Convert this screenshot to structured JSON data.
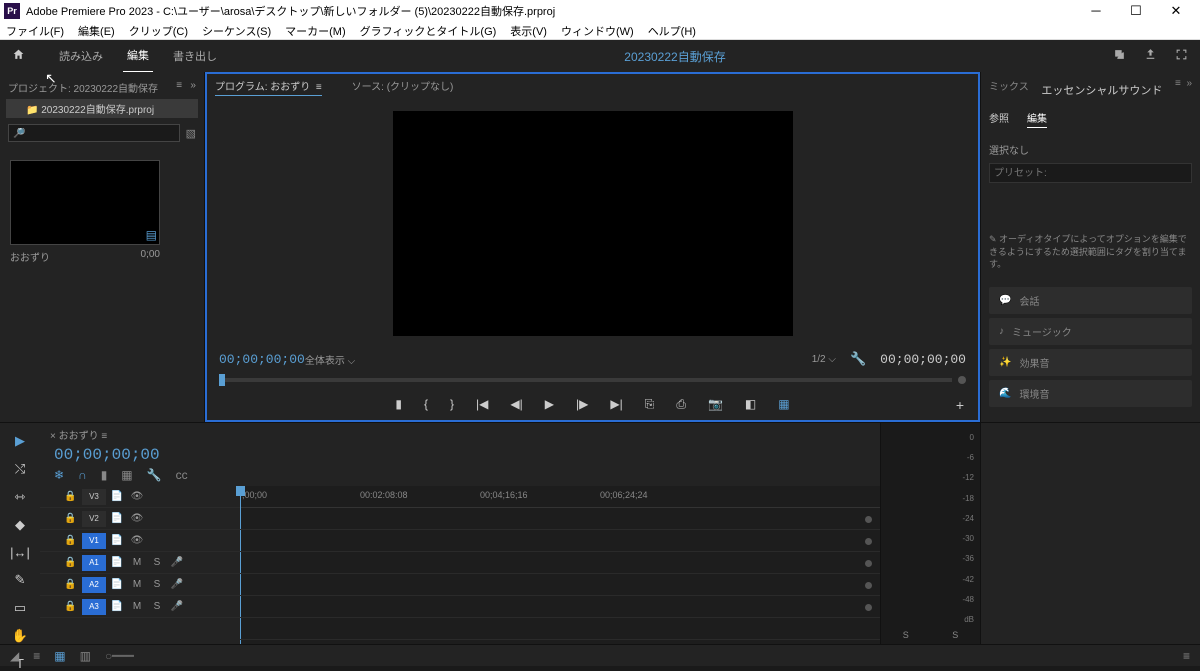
{
  "titlebar": {
    "app_icon": "Pr",
    "title": "Adobe Premiere Pro 2023 - C:\\ユーザー\\arosa\\デスクトップ\\新しいフォルダー (5)\\20230222自動保存.prproj"
  },
  "menubar": {
    "items": [
      "ファイル(F)",
      "編集(E)",
      "クリップ(C)",
      "シーケンス(S)",
      "マーカー(M)",
      "グラフィックとタイトル(G)",
      "表示(V)",
      "ウィンドウ(W)",
      "ヘルプ(H)"
    ]
  },
  "workspace": {
    "tabs": [
      "読み込み",
      "編集",
      "書き出し"
    ],
    "active_index": 1,
    "center_title": "20230222自動保存"
  },
  "project_panel": {
    "title": "プロジェクト: 20230222自動保存",
    "bin": "20230222自動保存.prproj",
    "search_placeholder": "",
    "clip_name": "おおずり",
    "clip_duration": "0;00"
  },
  "program_panel": {
    "tab1": "プログラム: おおずり",
    "tab2": "ソース: (クリップなし)",
    "fit_label": "全体表示",
    "scale_label": "1/2",
    "timecode_left": "00;00;00;00",
    "timecode_right": "00;00;00;00"
  },
  "essential_sound": {
    "mix_tab": "ミックス",
    "header": "エッセンシャルサウンド",
    "tabs": [
      "参照",
      "編集"
    ],
    "active_tab": 1,
    "no_selection": "選択なし",
    "preset_label": "プリセット:",
    "hint": "オーディオタイプによってオプションを編集できるようにするため選択範囲にタグを割り当てます。",
    "buttons": [
      "会話",
      "ミュージック",
      "効果音",
      "環境音"
    ]
  },
  "timeline": {
    "sequence_name": "おおずり",
    "timecode": "00;00;00;00",
    "ruler": [
      ";00;00",
      "00:02:08:08",
      "00;04;16;16",
      "00;06;24;24"
    ],
    "video_tracks": [
      {
        "name": "V3",
        "selected": false
      },
      {
        "name": "V2",
        "selected": false
      },
      {
        "name": "V1",
        "selected": true
      }
    ],
    "audio_tracks": [
      {
        "name": "A1",
        "selected": true
      },
      {
        "name": "A2",
        "selected": true
      },
      {
        "name": "A3",
        "selected": true
      }
    ]
  },
  "audio_meter": {
    "scale": [
      "0",
      "-6",
      "-12",
      "-18",
      "-24",
      "-30",
      "-36",
      "-42",
      "-48",
      "dB"
    ],
    "channels": [
      "S",
      "S"
    ]
  }
}
